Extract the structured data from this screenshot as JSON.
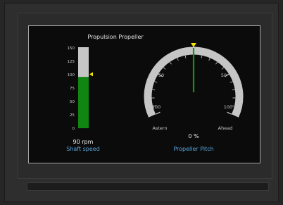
{
  "title": "Propulsion Propeller",
  "shaft": {
    "scale_ticks": [
      "150",
      "125",
      "100",
      "75",
      "50",
      "25",
      "0"
    ],
    "max": 150,
    "value": 95,
    "setpoint": 100,
    "reading": "90 rpm",
    "caption": "Shaft speed"
  },
  "pitch": {
    "labels": {
      "left_50": "50",
      "right_50": "50",
      "left_100": "100",
      "right_100": "100",
      "astern": "Astern",
      "ahead": "Ahead"
    },
    "value_percent": 0,
    "reading": "0 %",
    "caption": "Propeller Pitch"
  },
  "colors": {
    "bar_fill": "#118511",
    "bar_track": "#c6c6c6",
    "marker": "#f2e600",
    "needle": "#139513",
    "arc": "#c6c6c6",
    "caption": "#5aa8e0"
  }
}
